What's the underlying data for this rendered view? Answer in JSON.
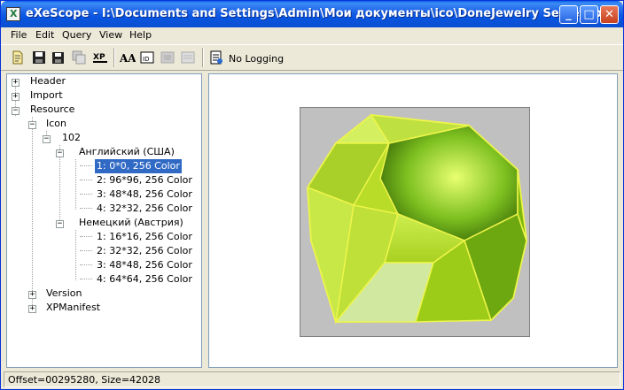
{
  "window": {
    "title": "eXeScope - I:\\Documents and Settings\\Admin\\Мои документы\\ico\\DoneJewelry Secret.exe"
  },
  "menu": [
    "File",
    "Edit",
    "Query",
    "View",
    "Help"
  ],
  "toolbar": {
    "logging_label": "No Logging",
    "icons": [
      "open-file-icon",
      "save-icon",
      "save-all-icon",
      "export-icon",
      "xp-icon",
      "font-icon",
      "dialog-icon",
      "image-icon",
      "menu-icon",
      "logging-icon"
    ]
  },
  "tree": {
    "header": "Header",
    "import": "Import",
    "resource": "Resource",
    "icon": "Icon",
    "icon_id": "102",
    "lang1": "Английский (США)",
    "lang1_items": [
      "1: 0*0, 256 Color",
      "2: 96*96, 256 Color",
      "3: 48*48, 256 Color",
      "4: 32*32, 256 Color"
    ],
    "lang2": "Немецкий (Австрия)",
    "lang2_items": [
      "1: 16*16, 256 Color",
      "2: 32*32, 256 Color",
      "3: 48*48, 256 Color",
      "4: 64*64, 256 Color"
    ],
    "version": "Version",
    "xpmanifest": "XPManifest",
    "selected_item": "1: 0*0, 256 Color"
  },
  "preview": {
    "image_description": "gem-icon",
    "background_color": "#C0C0C0",
    "gem_color": "#B8E020"
  },
  "status": {
    "text": "Offset=00295280, Size=42028"
  }
}
